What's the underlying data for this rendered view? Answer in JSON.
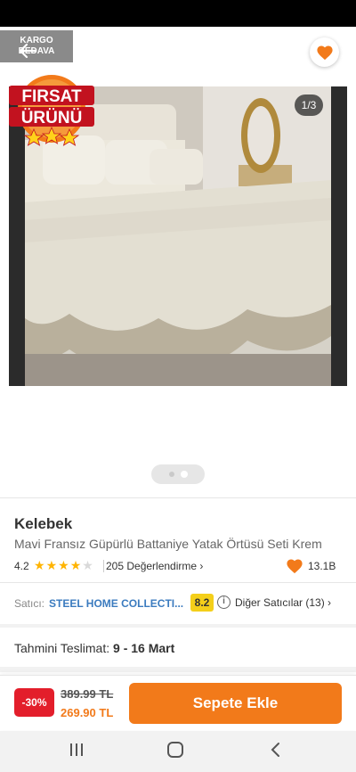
{
  "badges": {
    "cargo_line1": "KARGO",
    "cargo_line2": "BEDAVA",
    "firsat_line1": "FIRSAT",
    "firsat_line2": "ÜRÜNÜ"
  },
  "gallery": {
    "counter": "1/3",
    "active_index": 1,
    "total_dots": 2
  },
  "product": {
    "brand": "Kelebek",
    "name": "Mavi Fransız Güpürlü Battaniye Yatak Örtüsü Seti Krem",
    "rating": "4.2",
    "rating_value": 4.2,
    "reviews": "205 Değerlendirme",
    "favorites": "13.1B"
  },
  "seller": {
    "label": "Satıcı:",
    "name": "STEEL HOME COLLECTI...",
    "score": "8.2",
    "other_sellers": "Diğer Satıcılar (13)"
  },
  "delivery": {
    "label": "Tahmini Teslimat:",
    "dates": "9 - 16 Mart"
  },
  "pricing": {
    "discount": "-30%",
    "old_price": "389.99 TL",
    "new_price": "269.90 TL",
    "cart_button": "Sepete Ekle"
  },
  "colors": {
    "accent": "#f27a1a",
    "discount": "#e31e2b",
    "seller_link": "#3b7bbf",
    "score_badge": "#f4cf1a"
  },
  "icons": {
    "back": "back-arrow-icon",
    "share": "share-icon",
    "favorite": "heart-icon",
    "info": "info-icon",
    "chevron": "chevron-right-icon"
  }
}
